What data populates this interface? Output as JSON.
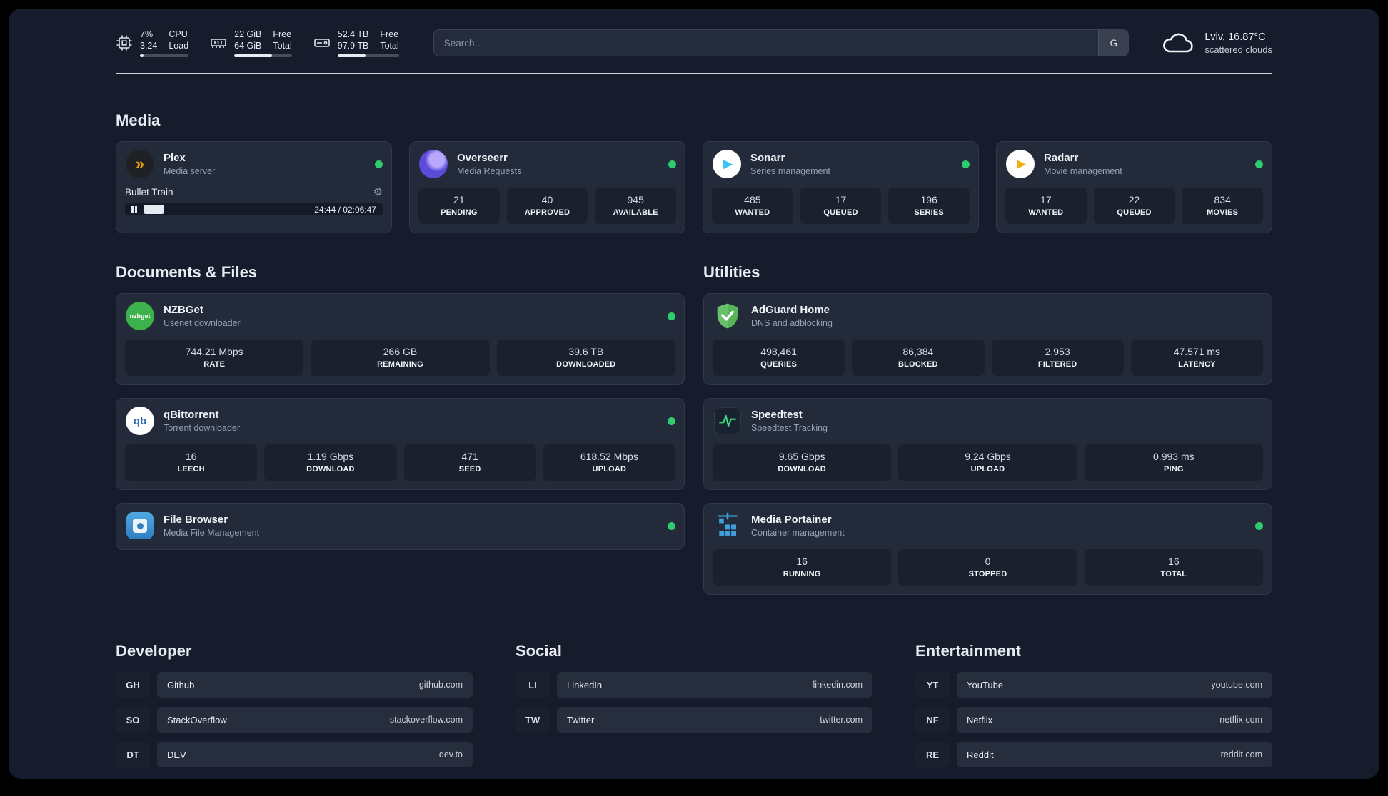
{
  "colors": {
    "status_online": "#2fcb6f",
    "plex_amber": "#e5a00d",
    "sonarr_blue": "#35c5f4",
    "radarr_amber": "#f1b012",
    "nzbget_green": "#3db14c",
    "adguard_green": "#57b558",
    "portainer_blue": "#3f9fdf",
    "overseerr_purple": "#5b4bd8"
  },
  "icons": {
    "gear": "⚙",
    "play": "▶",
    "plex_chevron": "»"
  },
  "topbar": {
    "cpu": {
      "value1": "7%",
      "value2": "3.24",
      "label1": "CPU",
      "label2": "Load",
      "bar_percent": 7
    },
    "ram": {
      "value1": "22 GiB",
      "value2": "64 GiB",
      "label1": "Free",
      "label2": "Total",
      "bar_percent": 66
    },
    "disk": {
      "value1": "52.4 TB",
      "value2": "97.9 TB",
      "label1": "Free",
      "label2": "Total",
      "bar_percent": 46
    },
    "search": {
      "placeholder": "Search...",
      "button_label": "G"
    },
    "weather": {
      "location": "Lviv, 16.87°C",
      "condition": "scattered clouds"
    }
  },
  "media": {
    "title": "Media",
    "plex": {
      "name": "Plex",
      "subtitle": "Media server",
      "now_playing": "Bullet Train",
      "time": "24:44 / 02:06:47",
      "progress_percent": 8
    },
    "overseerr": {
      "name": "Overseerr",
      "subtitle": "Media Requests",
      "stats": [
        {
          "value": "21",
          "label": "PENDING"
        },
        {
          "value": "40",
          "label": "APPROVED"
        },
        {
          "value": "945",
          "label": "AVAILABLE"
        }
      ]
    },
    "sonarr": {
      "name": "Sonarr",
      "subtitle": "Series management",
      "stats": [
        {
          "value": "485",
          "label": "WANTED"
        },
        {
          "value": "17",
          "label": "QUEUED"
        },
        {
          "value": "196",
          "label": "SERIES"
        }
      ]
    },
    "radarr": {
      "name": "Radarr",
      "subtitle": "Movie management",
      "stats": [
        {
          "value": "17",
          "label": "WANTED"
        },
        {
          "value": "22",
          "label": "QUEUED"
        },
        {
          "value": "834",
          "label": "MOVIES"
        }
      ]
    }
  },
  "documents": {
    "title": "Documents & Files",
    "nzbget": {
      "name": "NZBGet",
      "subtitle": "Usenet downloader",
      "icon_text": "nzbget",
      "stats": [
        {
          "value": "744.21 Mbps",
          "label": "RATE"
        },
        {
          "value": "266 GB",
          "label": "REMAINING"
        },
        {
          "value": "39.6 TB",
          "label": "DOWNLOADED"
        }
      ]
    },
    "qbittorrent": {
      "name": "qBittorrent",
      "subtitle": "Torrent downloader",
      "icon_text": "qb",
      "stats": [
        {
          "value": "16",
          "label": "LEECH"
        },
        {
          "value": "1.19 Gbps",
          "label": "DOWNLOAD"
        },
        {
          "value": "471",
          "label": "SEED"
        },
        {
          "value": "618.52 Mbps",
          "label": "UPLOAD"
        }
      ]
    },
    "filebrowser": {
      "name": "File Browser",
      "subtitle": "Media File Management"
    }
  },
  "utilities": {
    "title": "Utilities",
    "adguard": {
      "name": "AdGuard Home",
      "subtitle": "DNS and adblocking",
      "stats": [
        {
          "value": "498,461",
          "label": "QUERIES"
        },
        {
          "value": "86,384",
          "label": "BLOCKED"
        },
        {
          "value": "2,953",
          "label": "FILTERED"
        },
        {
          "value": "47.571 ms",
          "label": "LATENCY"
        }
      ]
    },
    "speedtest": {
      "name": "Speedtest",
      "subtitle": "Speedtest Tracking",
      "stats": [
        {
          "value": "9.65 Gbps",
          "label": "DOWNLOAD"
        },
        {
          "value": "9.24 Gbps",
          "label": "UPLOAD"
        },
        {
          "value": "0.993 ms",
          "label": "PING"
        }
      ]
    },
    "portainer": {
      "name": "Media Portainer",
      "subtitle": "Container management",
      "stats": [
        {
          "value": "16",
          "label": "RUNNING"
        },
        {
          "value": "0",
          "label": "STOPPED"
        },
        {
          "value": "16",
          "label": "TOTAL"
        }
      ]
    }
  },
  "bookmarks": {
    "developer": {
      "title": "Developer",
      "items": [
        {
          "abbr": "GH",
          "name": "Github",
          "url": "github.com"
        },
        {
          "abbr": "SO",
          "name": "StackOverflow",
          "url": "stackoverflow.com"
        },
        {
          "abbr": "DT",
          "name": "DEV",
          "url": "dev.to"
        }
      ]
    },
    "social": {
      "title": "Social",
      "items": [
        {
          "abbr": "LI",
          "name": "LinkedIn",
          "url": "linkedin.com"
        },
        {
          "abbr": "TW",
          "name": "Twitter",
          "url": "twitter.com"
        }
      ]
    },
    "entertainment": {
      "title": "Entertainment",
      "items": [
        {
          "abbr": "YT",
          "name": "YouTube",
          "url": "youtube.com"
        },
        {
          "abbr": "NF",
          "name": "Netflix",
          "url": "netflix.com"
        },
        {
          "abbr": "RE",
          "name": "Reddit",
          "url": "reddit.com"
        }
      ]
    }
  }
}
